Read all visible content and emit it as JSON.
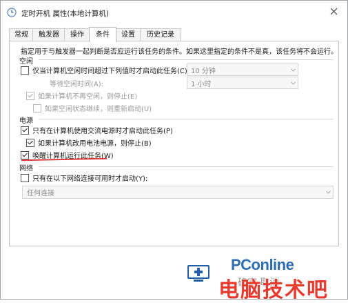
{
  "window": {
    "title": "定时开机 属性(本地计算机)"
  },
  "tabs": [
    {
      "label": "常规"
    },
    {
      "label": "触发器"
    },
    {
      "label": "操作"
    },
    {
      "label": "条件",
      "active": true
    },
    {
      "label": "设置"
    },
    {
      "label": "历史记录"
    }
  ],
  "panel": {
    "intro": "指定用于与触发器一起判断是否应运行该任务的条件。如果这里指定的条件不是真，该任务将不会运行。",
    "idle": {
      "section": "空闲",
      "start_if_idle": {
        "label": "仅当计算机空闲时间超过下列值时才启动此任务(C):",
        "checked": false
      },
      "idle_duration": {
        "value": "10 分钟"
      },
      "wait_label": "等待空闲时间(A):",
      "wait_duration": {
        "value": "1 小时"
      },
      "stop_if_not_idle": {
        "label": "如果计算机不再空闲，则停止(E)",
        "checked": true,
        "disabled": true
      },
      "restart_if_idle": {
        "label": "如果空闲状态继续，则重新启动(U)",
        "checked": false,
        "disabled": true
      }
    },
    "power": {
      "section": "电源",
      "ac_only": {
        "label": "只有在计算机使用交流电源时才启动此任务(P)",
        "checked": true
      },
      "stop_on_battery": {
        "label": "如果计算机改用电池电源，则停止(B)",
        "checked": true
      },
      "wake_to_run": {
        "label": "唤醒计算机运行此任务(W)",
        "checked": true
      }
    },
    "network": {
      "section": "网络",
      "only_if_connection": {
        "label": "只有在以下网络连接可用时才启动(Y):",
        "checked": false
      },
      "connection": {
        "value": "任何连接"
      }
    }
  },
  "watermark": {
    "brand": "PConline",
    "cn": "电脑技术吧",
    "underlying": "确定  取消"
  },
  "colors": {
    "annotation": "#e23a3a",
    "brand_blue": "#2b6db3",
    "brand_red": "#e8392d"
  }
}
